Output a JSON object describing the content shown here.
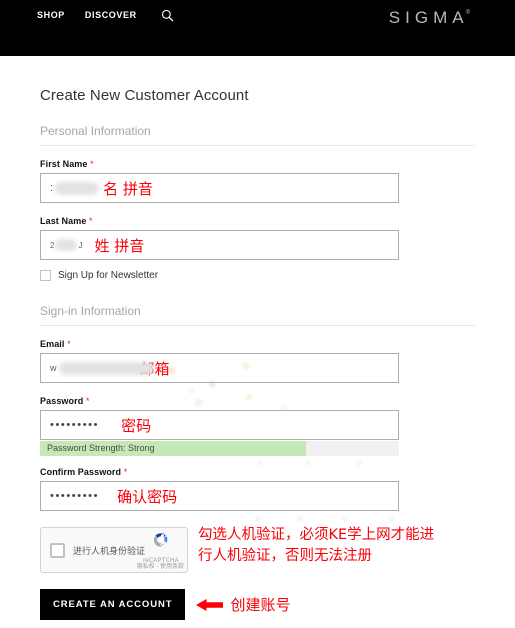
{
  "header": {
    "nav": [
      {
        "label": "SHOP",
        "name": "nav-shop"
      },
      {
        "label": "DISCOVER",
        "name": "nav-discover"
      }
    ],
    "search_icon": "search-icon",
    "brand": "SIGMA",
    "brand_mark": "®"
  },
  "main": {
    "page_title": "Create New Customer Account",
    "personal": {
      "legend": "Personal Information",
      "first_name": {
        "label": "First Name",
        "required_mark": "*",
        "value_prefix": ":",
        "annotation": "名 拼音"
      },
      "last_name": {
        "label": "Last Name",
        "required_mark": "*",
        "value_prefix": "2",
        "value_suffix": "J",
        "annotation": "姓 拼音"
      },
      "newsletter": {
        "label": "Sign Up for Newsletter",
        "checked": false
      }
    },
    "signin": {
      "legend": "Sign-in Information",
      "email": {
        "label": "Email",
        "required_mark": "*",
        "value_prefix": "w",
        "annotation": "邮箱"
      },
      "password": {
        "label": "Password",
        "required_mark": "*",
        "value": "•••••••••",
        "annotation": "密码",
        "strength_text": "Password Strength: Strong",
        "strength_fill_percent": 74,
        "strength_color": "#c5e8b7"
      },
      "confirm_password": {
        "label": "Confirm Password",
        "required_mark": "*",
        "value": "•••••••••",
        "annotation": "确认密码"
      }
    },
    "recaptcha": {
      "checkbox_label": "进行人机身份验证",
      "brand": "reCAPTCHA",
      "terms": "隐私权 - 使用条款",
      "checked": false,
      "annotation_line1": "勾选人机验证，必须KE学上网才能进",
      "annotation_line2": "行人机验证，否则无法注册"
    },
    "submit": {
      "label": "CREATE AN ACCOUNT",
      "annotation": "创建账号"
    }
  },
  "colors": {
    "header_bg": "#000000",
    "annotation_red": "#fb0007",
    "required_red": "#e02b27",
    "strength_green": "#c5e8b7",
    "logo_gray": "#b9b9b9"
  }
}
